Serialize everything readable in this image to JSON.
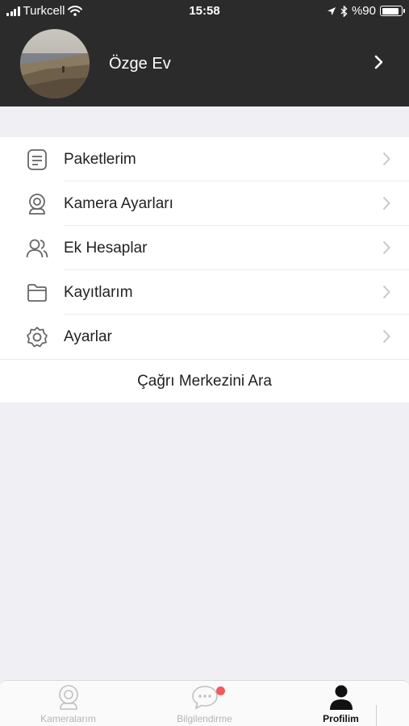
{
  "status_bar": {
    "carrier": "Turkcell",
    "time": "15:58",
    "battery": "%90",
    "battery_level": 0.9
  },
  "header": {
    "account_name": "Özge Ev",
    "avatar_icon": "profile-photo-icon",
    "chevron_icon": "chevron-right-icon"
  },
  "menu": {
    "items": [
      {
        "label": "Paketlerim",
        "icon": "packages-icon"
      },
      {
        "label": "Kamera Ayarları",
        "icon": "camera-icon"
      },
      {
        "label": "Ek Hesaplar",
        "icon": "users-icon"
      },
      {
        "label": "Kayıtlarım",
        "icon": "folder-icon"
      },
      {
        "label": "Ayarlar",
        "icon": "gear-icon"
      }
    ],
    "call_center": "Çağrı Merkezini Ara"
  },
  "tab_bar": {
    "tabs": [
      {
        "label": "Kameralarım",
        "icon": "camera-icon",
        "active": false
      },
      {
        "label": "Bilgilendirme",
        "icon": "chat-bubble-icon",
        "active": false,
        "badge": true
      },
      {
        "label": "Profilim",
        "icon": "person-icon",
        "active": true
      }
    ]
  },
  "colors": {
    "header_bg": "#2b2b2b",
    "page_bg": "#efeff4",
    "badge": "#f05a5a",
    "active_tab": "#111111",
    "inactive_tab": "#b5b5b5"
  }
}
